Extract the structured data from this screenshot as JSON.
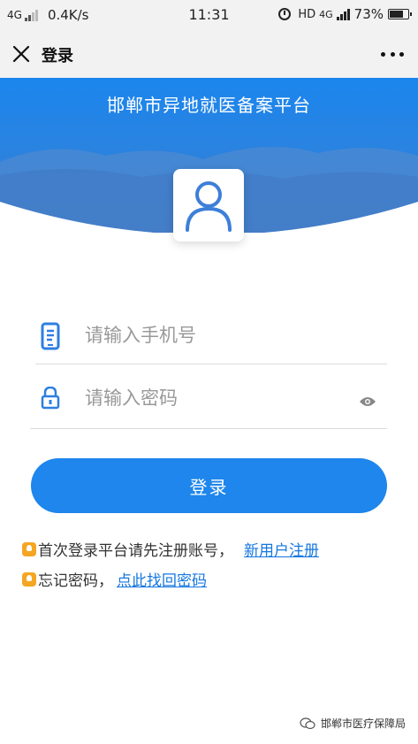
{
  "status_bar": {
    "network": "4G",
    "speed": "0.4K/s",
    "time": "11:31",
    "hd": "HD",
    "net_type": "4G",
    "battery": "73%",
    "battery_level": 0.73
  },
  "nav": {
    "title": "登录"
  },
  "banner": {
    "title": "邯郸市异地就医备案平台",
    "color": "#1e86ec"
  },
  "form": {
    "phone_placeholder": "请输入手机号",
    "password_placeholder": "请输入密码",
    "login_label": "登录"
  },
  "tips": {
    "register_text": "首次登录平台请先注册账号，",
    "register_link": "新用户注册",
    "forgot_text": "忘记密码，",
    "forgot_link": "点此找回密码"
  },
  "watermark": {
    "text": "邯郸市医疗保障局"
  },
  "icons": [
    "close-icon",
    "more-icon",
    "user-icon",
    "phone-icon",
    "lock-icon",
    "eye-icon",
    "bulb-icon",
    "wechat-icon"
  ]
}
